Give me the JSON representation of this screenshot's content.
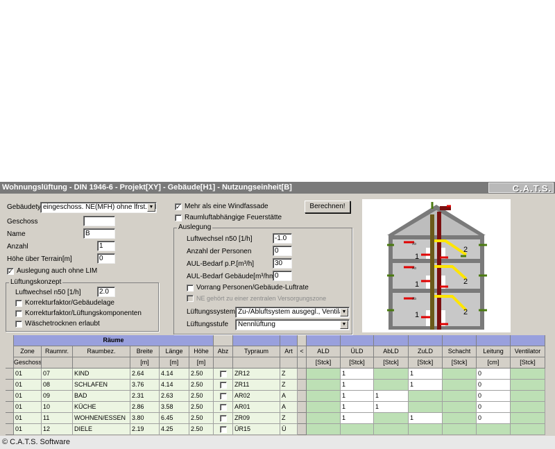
{
  "window": {
    "title": "Wohnungslüftung - DIN 1946-6 - Projekt[XY] - Gebäude[H1] - Nutzungseinheit[B]",
    "logo": "C.A.T.S."
  },
  "left": {
    "gebaeudetyp_label": "Gebäudetyp",
    "gebaeudetyp_value": "eingeschoss. NE(MFH) ohne lfrst.Sch...",
    "geschoss_label": "Geschoss",
    "geschoss_value": "",
    "name_label": "Name",
    "name_value": "B",
    "anzahl_label": "Anzahl",
    "anzahl_value": "1",
    "hoehe_label": "Höhe über Terrain[m]",
    "hoehe_value": "0",
    "auslegung_lim_label": "Auslegung auch ohne LIM",
    "lueftungskonzept": {
      "title": "Lüftungskonzept",
      "luftwechsel_label": "Luftwechsel n50 [1/h]",
      "luftwechsel_value": "2.0",
      "kf_gebaeudelage": "Korrekturfaktor/Gebäudelage",
      "kf_lueftungskomponenten": "Korrekturfaktor/Lüftungskomponenten",
      "waeschetrocknen": "Wäschetrocknen erlaubt"
    }
  },
  "middle": {
    "mehr_windfassade": "Mehr als eine Windfassade",
    "raumluft_feuerstaette": "Raumluftabhängige Feuerstätte",
    "berechnen": "Berechnen!",
    "auslegung": {
      "title": "Auslegung",
      "luftwechsel_label": "Luftwechsel n50 [1/h]",
      "luftwechsel_value": "-1.0",
      "personen_label": "Anzahl der Personen",
      "personen_value": "0",
      "aul_pp_label": "AUL-Bedarf p.P.[m³/h]",
      "aul_pp_value": "30",
      "aul_geb_label": "AUL-Bedarf Gebäude[m³/hm²]",
      "aul_geb_value": "0",
      "vorrang_label": "Vorrang Personen/Gebäude-Luftrate",
      "ne_zentral_label": "NE gehört zu einer zentralen Versorgungszone",
      "system_label": "Lüftungssystem",
      "system_value": "Zu-/Abluftsystem ausgegl., Ventilator ...",
      "stufe_label": "Lüftungsstufe",
      "stufe_value": "Nennlüftung"
    }
  },
  "diagram": {
    "labels": [
      "1",
      "2",
      "1",
      "2",
      "1",
      "2"
    ],
    "stack_labels": [
      "Ab",
      "Ab",
      "Ab"
    ]
  },
  "table": {
    "group_header": "Räume",
    "columns": [
      "Zone",
      "Raumnr.",
      "Raumbez.",
      "Breite",
      "Länge",
      "Höhe",
      "Abz",
      "Typraum",
      "Art",
      "<",
      "ALD",
      "ÜLD",
      "AbLD",
      "ZuLD",
      "Schacht",
      "Leitung",
      "Ventilator"
    ],
    "units": [
      "Geschoss",
      "",
      "",
      "[m]",
      "[m]",
      "[m]",
      "",
      "",
      "",
      "",
      "[Stck]",
      "[Stck]",
      "[Stck]",
      "[Stck]",
      "[Stck]",
      "[cm]",
      "[Stck]"
    ],
    "rows": [
      {
        "zone": "01",
        "nr": "07",
        "bez": "KIND",
        "breite": "2.64",
        "laenge": "4.14",
        "hoehe": "2.50",
        "typ": "ZR12",
        "art": "Z",
        "ald": "",
        "uld": "1",
        "abld": "",
        "zuld": "1",
        "schacht": "",
        "leitung": "0",
        "vent": ""
      },
      {
        "zone": "01",
        "nr": "08",
        "bez": "SCHLAFEN",
        "breite": "3.76",
        "laenge": "4.14",
        "hoehe": "2.50",
        "typ": "ZR11",
        "art": "Z",
        "ald": "",
        "uld": "1",
        "abld": "",
        "zuld": "1",
        "schacht": "",
        "leitung": "0",
        "vent": ""
      },
      {
        "zone": "01",
        "nr": "09",
        "bez": "BAD",
        "breite": "2.31",
        "laenge": "2.63",
        "hoehe": "2.50",
        "typ": "AR02",
        "art": "A",
        "ald": "",
        "uld": "1",
        "abld": "1",
        "zuld": "",
        "schacht": "",
        "leitung": "0",
        "vent": ""
      },
      {
        "zone": "01",
        "nr": "10",
        "bez": "KÜCHE",
        "breite": "2.86",
        "laenge": "3.58",
        "hoehe": "2.50",
        "typ": "AR01",
        "art": "A",
        "ald": "",
        "uld": "1",
        "abld": "1",
        "zuld": "",
        "schacht": "",
        "leitung": "0",
        "vent": ""
      },
      {
        "zone": "01",
        "nr": "11",
        "bez": "WOHNEN/ESSEN",
        "breite": "3.80",
        "laenge": "6.45",
        "hoehe": "2.50",
        "typ": "ZR09",
        "art": "Z",
        "ald": "",
        "uld": "1",
        "abld": "",
        "zuld": "1",
        "schacht": "",
        "leitung": "0",
        "vent": ""
      },
      {
        "zone": "01",
        "nr": "12",
        "bez": "DIELE",
        "breite": "2.19",
        "laenge": "4.25",
        "hoehe": "2.50",
        "typ": "ÜR15",
        "art": "Ü",
        "ald": "",
        "uld": "",
        "abld": "",
        "zuld": "",
        "schacht": "",
        "leitung": "",
        "vent": ""
      }
    ]
  },
  "footer": {
    "copyright": "© C.A.T.S. Software"
  }
}
